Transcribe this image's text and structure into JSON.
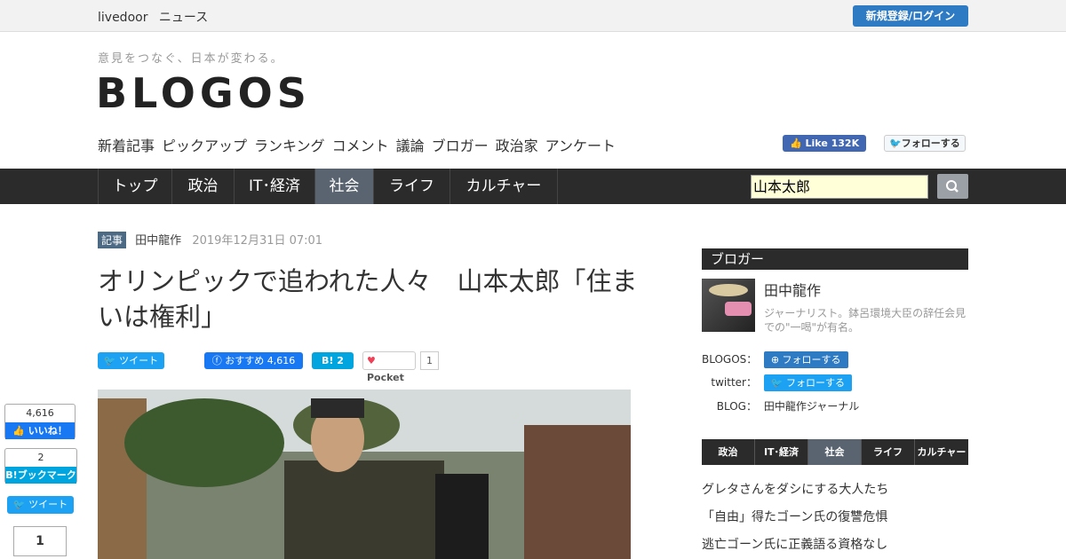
{
  "topbar": {
    "brand_1": "livedoor",
    "brand_2": "ニュース",
    "register": "新規登録/ログイン"
  },
  "header": {
    "tagline": "意見をつなぐ、日本が変わる。",
    "logo": "BLOGOS",
    "subnav": [
      "新着記事",
      "ピックアップ",
      "ランキング",
      "コメント",
      "議論",
      "ブロガー",
      "政治家",
      "アンケート"
    ],
    "fb_like": "Like 132K",
    "tw_follow": "フォローする"
  },
  "navbar": {
    "items": [
      "トップ",
      "政治",
      "IT･経済",
      "社会",
      "ライフ",
      "カルチャー"
    ],
    "active": "社会",
    "search_value": "山本太郎"
  },
  "article": {
    "tag": "記事",
    "author": "田中龍作",
    "date": "2019年12月31日 07:01",
    "title": "オリンピックで追われた人々　山本太郎「住まいは権利」",
    "share_tw": "ツイート",
    "share_fb": "おすすめ 4,616",
    "share_hb": "2",
    "pocket": "Pocket",
    "pocket_count": "1"
  },
  "left_share": {
    "fb_count": "4,616",
    "fb_btn": "いいね！",
    "hb_count": "2",
    "hb_btn": "ブックマーク",
    "tw_btn": "ツイート",
    "pocket_count": "1"
  },
  "sidebar": {
    "heading": "ブロガー",
    "name": "田中龍作",
    "desc": "ジャーナリスト。鉢呂環境大臣の辞任会見での\"一喝\"が有名。",
    "rows": [
      {
        "label": "BLOGOS：",
        "value": "フォローする"
      },
      {
        "label": "twitter：",
        "value": "フォローする"
      },
      {
        "label": "BLOG：",
        "value": "田中龍作ジャーナル"
      }
    ],
    "cat_tabs": [
      "政治",
      "IT･経済",
      "社会",
      "ライフ",
      "カルチャー"
    ],
    "cat_active": "社会",
    "news": [
      "グレタさんをダシにする大人たち",
      "「自由」得たゴーン氏の復讐危惧",
      "逃亡ゴーン氏に正義語る資格なし"
    ]
  },
  "colors": {
    "accent": "#2e7bc4",
    "nav_bg": "#2b2b2b",
    "active_tab": "#5a6470",
    "tag_bg": "#4d6a85"
  }
}
